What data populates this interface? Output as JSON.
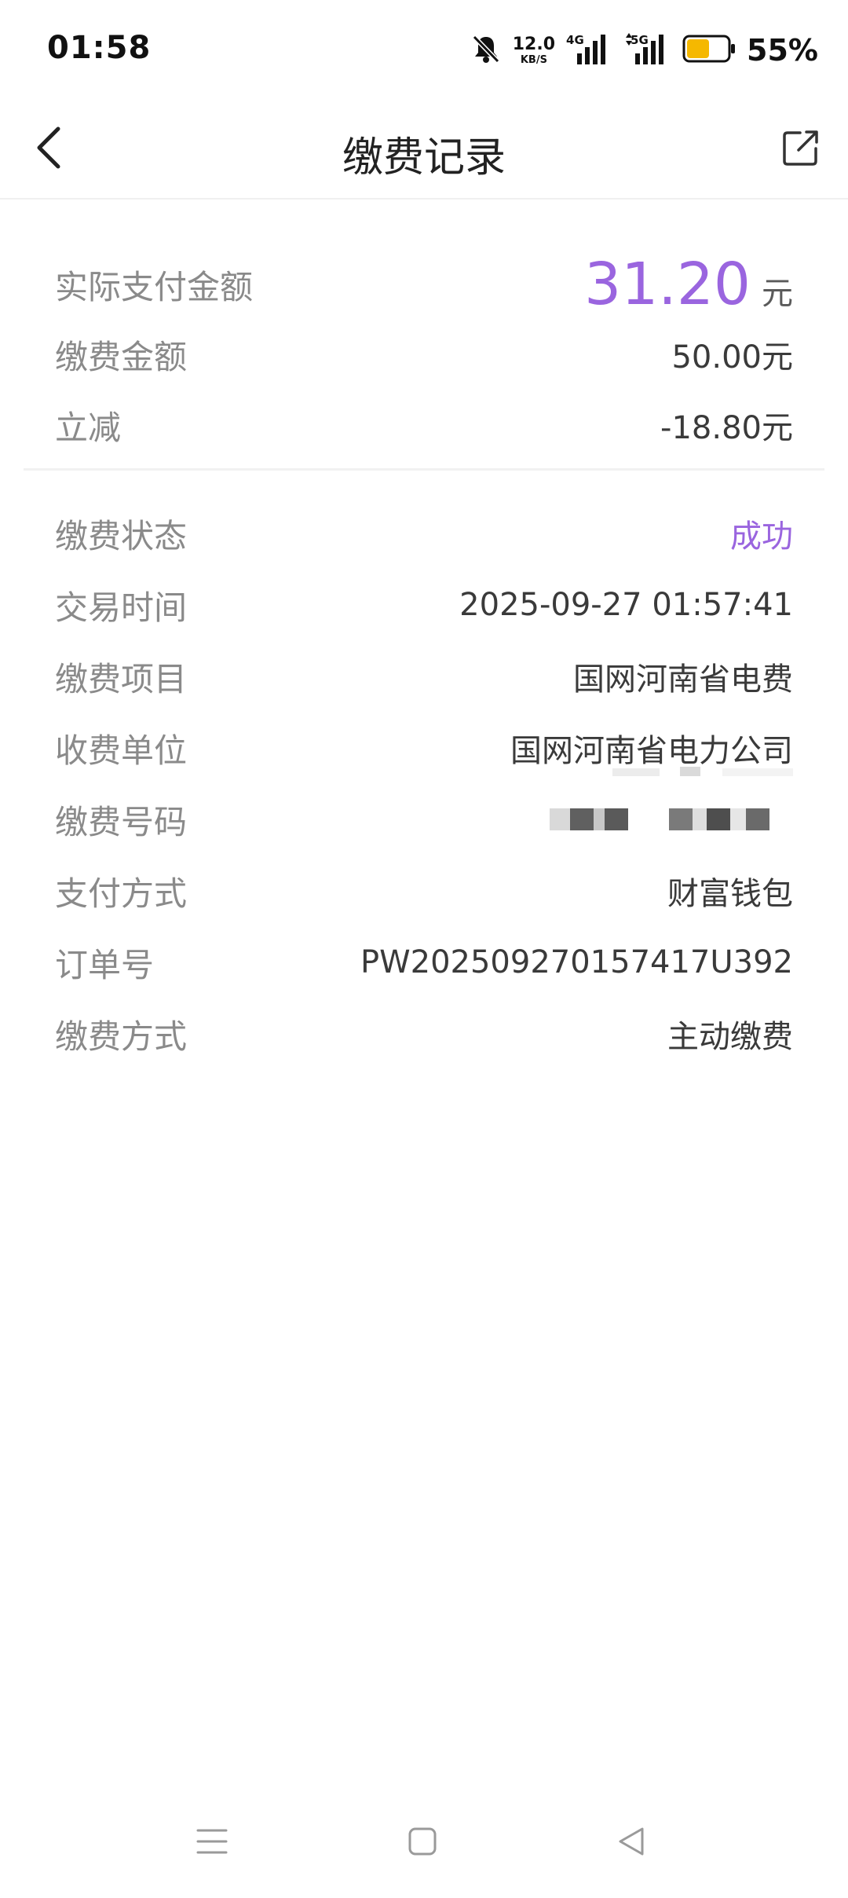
{
  "status_bar": {
    "time": "01:58",
    "net_speed_value": "12.0",
    "net_speed_unit": "KB/S",
    "signal_1_tech": "4G",
    "signal_2_tech": "5G",
    "battery_percent": "55%",
    "battery_level": 0.55,
    "battery_color": "#f5b800",
    "icons": [
      "bell-muted-icon",
      "signal-4g-icon",
      "signal-5g-icon",
      "battery-icon"
    ]
  },
  "header": {
    "title": "缴费记录",
    "back_icon": "chevron-left-icon",
    "share_icon": "share-icon"
  },
  "amounts": {
    "actual_label": "实际支付金额",
    "actual_value": "31.20",
    "actual_unit": "元",
    "payment_label": "缴费金额",
    "payment_value": "50.00元",
    "discount_label": "立减",
    "discount_value": "-18.80元"
  },
  "details": [
    {
      "label": "缴费状态",
      "value": "成功"
    },
    {
      "label": "交易时间",
      "value": "2025-09-27 01:57:41"
    },
    {
      "label": "缴费项目",
      "value": "国网河南省电费"
    },
    {
      "label": "收费单位",
      "value": "国网河南省电力公司"
    },
    {
      "label": "缴费号码",
      "value": ""
    },
    {
      "label": "支付方式",
      "value": "财富钱包"
    },
    {
      "label": "订单号",
      "value": "PW202509270157417U392"
    },
    {
      "label": "缴费方式",
      "value": "主动缴费"
    }
  ],
  "colors": {
    "accent": "#9a65df",
    "label": "#8a8a8a",
    "value": "#3a3a3a"
  },
  "nav": {
    "icons": [
      "menu-icon",
      "home-square-icon",
      "back-triangle-icon"
    ]
  }
}
